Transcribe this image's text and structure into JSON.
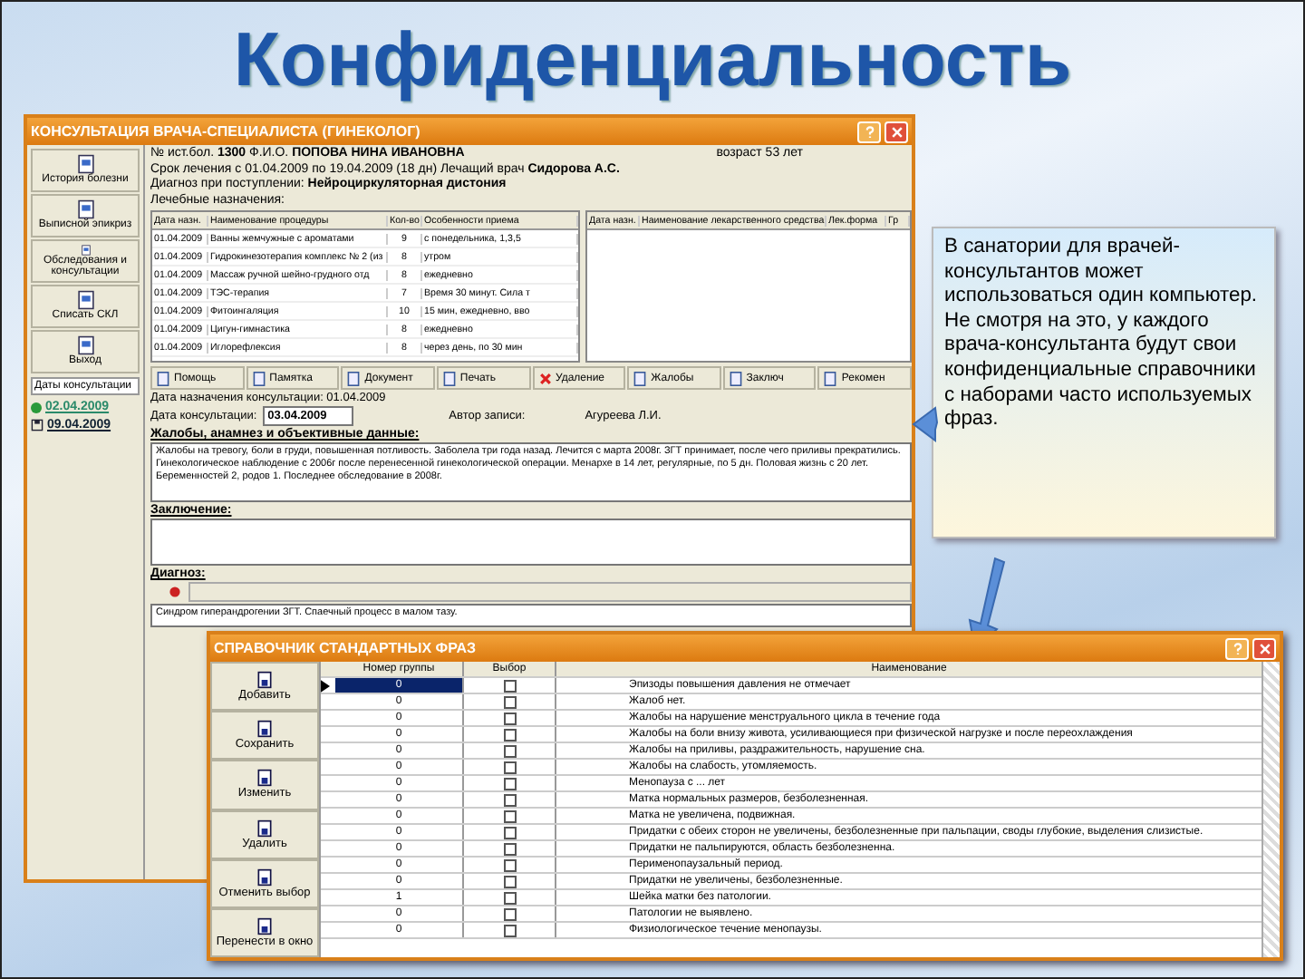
{
  "slide_title": "Конфиденциальность",
  "consult_window": {
    "title": "КОНСУЛЬТАЦИЯ ВРАЧА-СПЕЦИАЛИСТА (ГИНЕКОЛОГ)",
    "sidebar_buttons": [
      {
        "label": "История болезни"
      },
      {
        "label": "Выписной эпикриз"
      },
      {
        "label": "Обследования и консультации"
      },
      {
        "label": "Списать СКЛ"
      },
      {
        "label": "Выход"
      }
    ],
    "dates_label": "Даты консультации",
    "dates": [
      {
        "date": "02.04.2009",
        "kind": "done"
      },
      {
        "date": "09.04.2009",
        "kind": "planned"
      }
    ],
    "header": [
      {
        "left": "№ ист.бол. **1300**     Ф.И.О. **ПОПОВА НИНА ИВАНОВНА**",
        "right": "возраст 53 лет"
      },
      {
        "left": "Срок лечения с 01.04.2009 по 19.04.2009  (18 дн)  Лечащий врач **Сидорова А.С.**"
      },
      {
        "left": "Диагноз при поступлении: **Нейроциркуляторная дистония**"
      },
      {
        "left": "Лечебные назначения:"
      }
    ],
    "procedures": {
      "columns": [
        "Дата назн.",
        "Наименование процедуры",
        "Кол-во",
        "Особенности приема"
      ],
      "rows": [
        [
          "01.04.2009",
          "Ванны жемчужные с ароматами",
          "9",
          "с понедельника, 1,3,5"
        ],
        [
          "01.04.2009",
          "Гидрокинезотерапия комплекс № 2 (из",
          "8",
          "утром"
        ],
        [
          "01.04.2009",
          "Массаж ручной шейно-грудного отд",
          "8",
          "ежедневно"
        ],
        [
          "01.04.2009",
          "ТЭС-терапия",
          "7",
          "Время 30 минут. Сила т"
        ],
        [
          "01.04.2009",
          "Фитоингаляция",
          "10",
          "15 мин, ежедневно, вво"
        ],
        [
          "01.04.2009",
          "Цигун-гимнастика",
          "8",
          "ежедневно"
        ],
        [
          "01.04.2009",
          "Иглорефлексия",
          "8",
          "через день, по 30 мин"
        ]
      ]
    },
    "drugs": {
      "columns": [
        "Дата назн.",
        "Наименование лекарственного средства",
        "Лек.форма",
        "Гр"
      ]
    },
    "toolbar": [
      {
        "label": "Помощь",
        "kind": "page"
      },
      {
        "label": "Памятка",
        "kind": "page"
      },
      {
        "label": "Документ",
        "kind": "page"
      },
      {
        "label": "Печать",
        "kind": "page"
      },
      {
        "label": "Удаление",
        "kind": "delete"
      },
      {
        "label": "Жалобы",
        "kind": "page"
      },
      {
        "label": "Заключ",
        "kind": "page"
      },
      {
        "label": "Рекомен",
        "kind": "page"
      }
    ],
    "assigned_date": "Дата назначения консультации: 01.04.2009",
    "consult_date_label": "Дата консультации:",
    "consult_date": "03.04.2009",
    "author_label": "Автор записи:",
    "author": "Агуреева Л.И.",
    "complaints_label": "Жалобы, анамнез и объективные данные:",
    "complaints": "Жалобы на тревогу, боли в груди, повышенная потливость. Заболела три года назад. Лечится с марта 2008г. ЗГТ принимает, после чего приливы прекратились. Гинекологическое наблюдение с 2006г после перенесенной гинекологической операции. Менархе в 14 лет, регулярные, по 5 дн. Половая жизнь с 20 лет. Беременностей 2, родов 1. Последнее обследование в 2008г.",
    "conclusion_label": "Заключение:",
    "diagnosis_label": "Диагноз:",
    "diagnosis": "Синдром гиперандрогении ЗГТ. Спаечный процесс в малом тазу."
  },
  "callout": {
    "text": "В санатории для врачей-консультантов может использоваться один компьютер.  Не смотря на это, у каждого врача-консультанта будут свои конфиденциальные справочники с наборами часто используемых фраз."
  },
  "phrases_window": {
    "title": "СПРАВОЧНИК СТАНДАРТНЫХ ФРАЗ",
    "buttons": [
      "Добавить",
      "Сохранить",
      "Изменить",
      "Удалить",
      "Отменить выбор",
      "Перенести в окно"
    ],
    "columns": [
      "Номер группы",
      "Выбор",
      "Наименование"
    ],
    "rows": [
      {
        "group": "0",
        "chosen": false,
        "text": "Эпизоды повышения давления не отмечает",
        "selected": true
      },
      {
        "group": "0",
        "chosen": false,
        "text": "Жалоб нет.",
        "selected": false
      },
      {
        "group": "0",
        "chosen": false,
        "text": "Жалобы на нарушение менструального цикла в течение года",
        "selected": false
      },
      {
        "group": "0",
        "chosen": false,
        "text": "Жалобы на боли внизу живота, усиливающиеся при физической нагрузке и после переохлаждения",
        "selected": false
      },
      {
        "group": "0",
        "chosen": false,
        "text": "Жалобы на приливы, раздражительность, нарушение сна.",
        "selected": false
      },
      {
        "group": "0",
        "chosen": false,
        "text": "Жалобы на слабость, утомляемость.",
        "selected": false
      },
      {
        "group": "0",
        "chosen": false,
        "text": "Менопауза с ... лет",
        "selected": false
      },
      {
        "group": "0",
        "chosen": false,
        "text": "Матка нормальных размеров, безболезненная.",
        "selected": false
      },
      {
        "group": "0",
        "chosen": false,
        "text": "Матка не увеличена, подвижная.",
        "selected": false
      },
      {
        "group": "0",
        "chosen": false,
        "text": "Придатки с обеих сторон не увеличены, безболезненные при пальпации, своды глубокие, выделения слизистые.",
        "selected": false
      },
      {
        "group": "0",
        "chosen": false,
        "text": "Придатки не пальпируются, область безболезненна.",
        "selected": false
      },
      {
        "group": "0",
        "chosen": false,
        "text": "Перименопаузальный период.",
        "selected": false
      },
      {
        "group": "0",
        "chosen": false,
        "text": "Придатки не увеличены, безболезненные.",
        "selected": false
      },
      {
        "group": "1",
        "chosen": false,
        "text": "Шейка матки без патологии.",
        "selected": false
      },
      {
        "group": "0",
        "chosen": false,
        "text": "Патологии не выявлено.",
        "selected": false
      },
      {
        "group": "0",
        "chosen": false,
        "text": "Физиологическое течение менопаузы.",
        "selected": false
      }
    ]
  }
}
